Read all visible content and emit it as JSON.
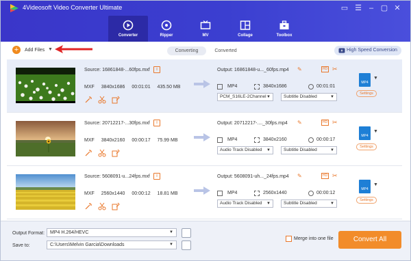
{
  "app": {
    "title": "4Videosoft Video Converter Ultimate"
  },
  "nav": [
    {
      "label": "Converter",
      "icon": "converter-icon",
      "active": true
    },
    {
      "label": "Ripper",
      "icon": "ripper-icon",
      "active": false
    },
    {
      "label": "MV",
      "icon": "mv-icon",
      "active": false
    },
    {
      "label": "Collage",
      "icon": "collage-icon",
      "active": false
    },
    {
      "label": "Toolbox",
      "icon": "toolbox-icon",
      "active": false
    }
  ],
  "toolbar": {
    "add_files": "Add Files",
    "tabs": [
      {
        "label": "Converting",
        "active": true
      },
      {
        "label": "Converted",
        "active": false
      }
    ],
    "high_speed": "High Speed Conversion"
  },
  "files": [
    {
      "source": "Source: 16861848-...60fps.mxf",
      "format": "MXF",
      "resolution": "3840x1686",
      "duration": "00:01:01",
      "size": "435.50 MB",
      "output": "Output: 16861848-u..._60fps.mp4",
      "out_format": "MP4",
      "out_resolution": "3840x1686",
      "out_duration": "00:01:01",
      "audio": "PCM_S16LE-2Channel",
      "subtitle": "Subtitle Disabled",
      "selected": true
    },
    {
      "source": "Source: 20712217-...30fps.mxf",
      "format": "MXF",
      "resolution": "3840x2160",
      "duration": "00:00:17",
      "size": "75.99 MB",
      "output": "Output: 20712217-...._30fps.mp4",
      "out_format": "MP4",
      "out_resolution": "3840x2160",
      "out_duration": "00:00:17",
      "audio": "Audio Track Disabled",
      "subtitle": "Subtitle Disabled",
      "selected": false
    },
    {
      "source": "Source: 5608091-u...24fps.mxf",
      "format": "MXF",
      "resolution": "2560x1440",
      "duration": "00:00:12",
      "size": "18.81 MB",
      "output": "Output: 5608091-uh..._24fps.mp4",
      "out_format": "MP4",
      "out_resolution": "2560x1440",
      "out_duration": "00:00:12",
      "audio": "Audio Track Disabled",
      "subtitle": "Subtitle Disabled",
      "selected": false
    }
  ],
  "format_badge": "MP4",
  "settings_label": "Settings",
  "bottom": {
    "output_format_label": "Output Format:",
    "output_format_value": "MP4 H.264/HEVC",
    "save_to_label": "Save to:",
    "save_to_value": "C:\\Users\\Melvin Garcia\\Downloads",
    "merge_label": "Merge into one file",
    "convert_all": "Convert All"
  },
  "colors": {
    "accent": "#f28c2a",
    "header": "#3a36c9",
    "selected_row": "#e8edf8"
  }
}
